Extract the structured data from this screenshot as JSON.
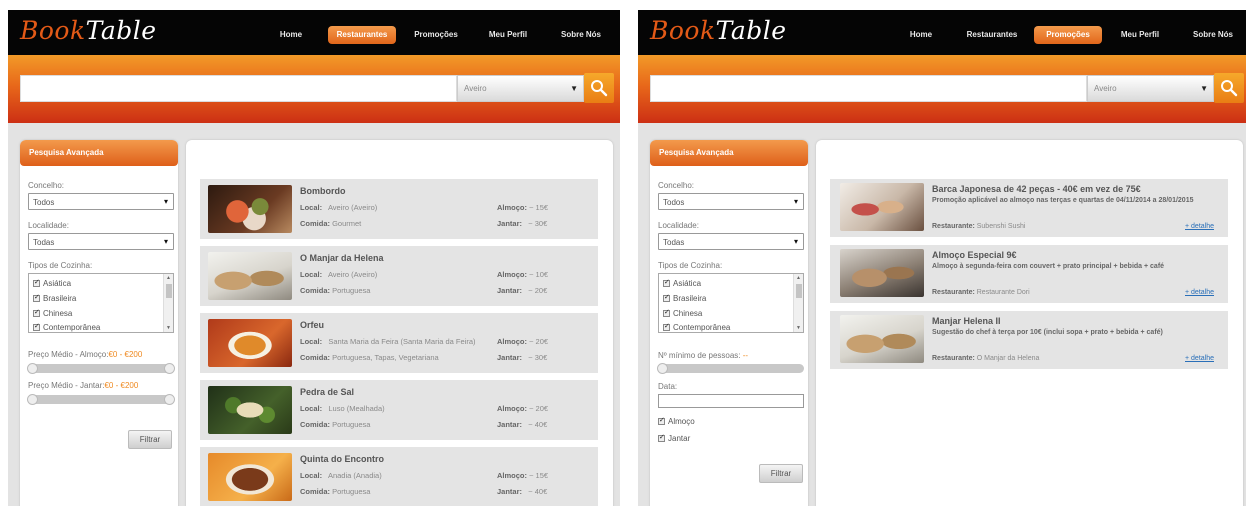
{
  "brand": {
    "book": "Book",
    "table": "Table"
  },
  "nav": [
    "Home",
    "Restaurantes",
    "Promoções",
    "Meu Perfil",
    "Sobre Nós"
  ],
  "colors": {
    "accent": "#e8681a",
    "link": "#2a6fb8"
  },
  "search": {
    "placeholder": "",
    "location": "Aveiro",
    "icon": "search-icon"
  },
  "sidebar": {
    "title": "Pesquisa Avançada",
    "concelho_label": "Concelho:",
    "concelho_value": "Todos",
    "localidade_label": "Localidade:",
    "localidade_value": "Todas",
    "cozinha_label": "Tipos de Cozinha:",
    "cozinhas": [
      "Asiática",
      "Brasileira",
      "Chinesa",
      "Contemporânea"
    ],
    "preco_almoco_label": "Preço Médio - Almoço:",
    "preco_almoco_range": "€0 - €200",
    "preco_jantar_label": "Preço Médio - Jantar:",
    "preco_jantar_range": "€0 - €200",
    "filter_button": "Filtrar",
    "pessoas_label": "Nº mínimo de pessoas:",
    "pessoas_value": "--",
    "data_label": "Data:",
    "almoco_check": "Almoço",
    "jantar_check": "Jantar"
  },
  "restaurants": [
    {
      "name": "Bombordo",
      "local_label": "Local:",
      "local": "Aveiro (Aveiro)",
      "comida_label": "Comida:",
      "comida": "Gourmet",
      "almoco_label": "Almoço:",
      "almoco": "~ 15€",
      "jantar_label": "Jantar:",
      "jantar": "~ 30€"
    },
    {
      "name": "O Manjar da Helena",
      "local_label": "Local:",
      "local": "Aveiro (Aveiro)",
      "comida_label": "Comida:",
      "comida": "Portuguesa",
      "almoco_label": "Almoço:",
      "almoco": "~ 10€",
      "jantar_label": "Jantar:",
      "jantar": "~ 20€"
    },
    {
      "name": "Orfeu",
      "local_label": "Local:",
      "local": "Santa Maria da Feira (Santa Maria da Feira)",
      "comida_label": "Comida:",
      "comida": "Portuguesa, Tapas, Vegetariana",
      "almoco_label": "Almoço:",
      "almoco": "~ 20€",
      "jantar_label": "Jantar:",
      "jantar": "~ 30€"
    },
    {
      "name": "Pedra de Sal",
      "local_label": "Local:",
      "local": "Luso (Mealhada)",
      "comida_label": "Comida:",
      "comida": "Portuguesa",
      "almoco_label": "Almoço:",
      "almoco": "~ 20€",
      "jantar_label": "Jantar:",
      "jantar": "~ 40€"
    },
    {
      "name": "Quinta do Encontro",
      "local_label": "Local:",
      "local": "Anadia (Anadia)",
      "comida_label": "Comida:",
      "comida": "Portuguesa",
      "almoco_label": "Almoço:",
      "almoco": "~ 15€",
      "jantar_label": "Jantar:",
      "jantar": "~ 40€"
    }
  ],
  "promotions": [
    {
      "title": "Barca Japonesa de 42 peças - 40€ em vez de 75€",
      "desc": "Promoção aplicável ao almoço nas terças e quartas de 04/11/2014 a 28/01/2015",
      "rest_label": "Restaurante:",
      "rest": "Subenshi Sushi",
      "link": "+ detalhe"
    },
    {
      "title": "Almoço Especial 9€",
      "desc": "Almoço à segunda-feira com couvert + prato principal + bebida + café",
      "rest_label": "Restaurante:",
      "rest": "Restaurante Dori",
      "link": "+ detalhe"
    },
    {
      "title": "Manjar Helena II",
      "desc": "Sugestão do chef à terça por 10€ (inclui sopa + prato + bebida + café)",
      "rest_label": "Restaurante:",
      "rest": "O Manjar da Helena",
      "link": "+ detalhe"
    }
  ]
}
